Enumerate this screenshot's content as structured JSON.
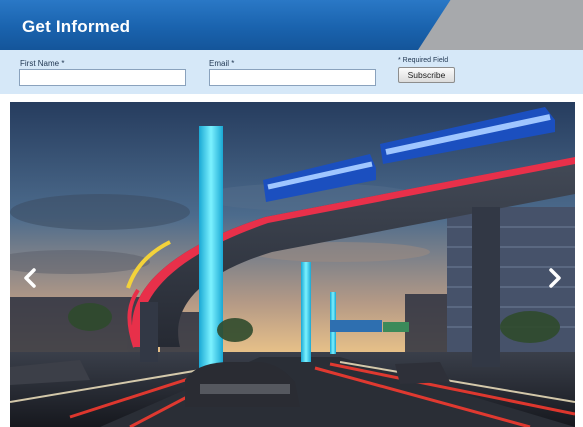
{
  "header": {
    "title": "Get Informed"
  },
  "form": {
    "first_name_label": "First Name *",
    "first_name_value": "",
    "email_label": "Email *",
    "email_value": "",
    "required_note": "* Required Field",
    "subscribe_label": "Subscribe"
  },
  "slider": {
    "prev_icon": "chevron-left-icon",
    "next_icon": "chevron-right-icon"
  },
  "colors": {
    "header_blue": "#1a63ae",
    "header_gray": "#a7a9ac",
    "form_bar": "#d6e8f8",
    "pylon_cyan": "#35d6f0",
    "train_blue": "#1b4fbf",
    "guideway_red": "#e8304a"
  }
}
